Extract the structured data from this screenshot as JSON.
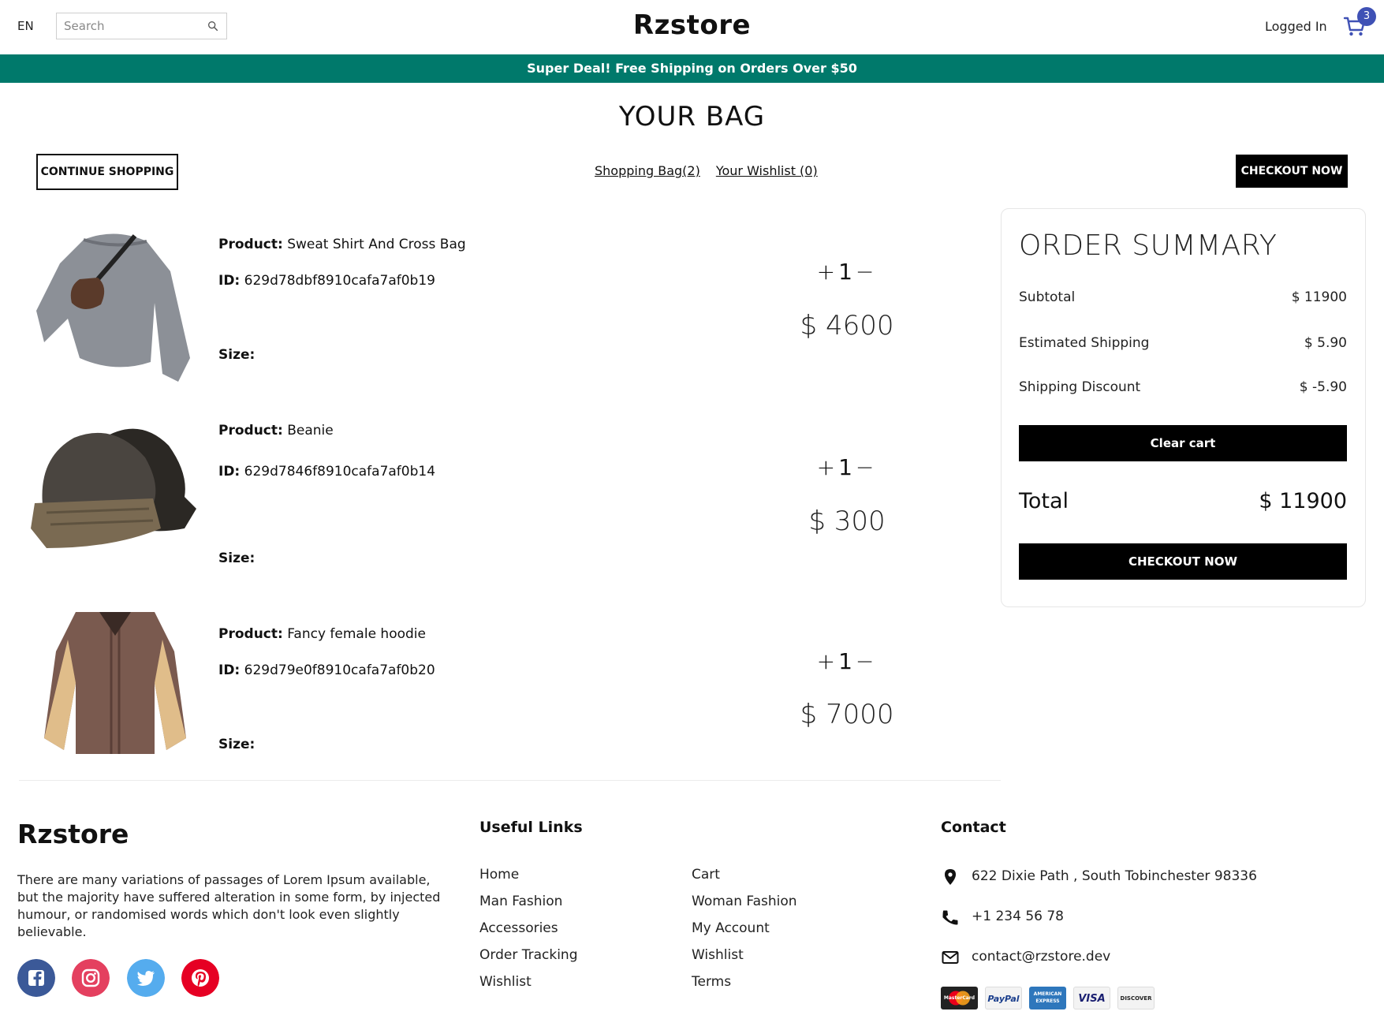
{
  "header": {
    "language": "EN",
    "search_placeholder": "Search",
    "brand": "Rzstore",
    "auth_status": "Logged In",
    "cart_count": "3"
  },
  "promo_banner": "Super Deal! Free Shipping on Orders Over $50",
  "page_title": "YOUR BAG",
  "actions": {
    "continue_shopping": "CONTINUE SHOPPING",
    "shopping_bag_link": "Shopping Bag(2)",
    "wishlist_link": "Your Wishlist (0)",
    "checkout_now": "CHECKOUT NOW"
  },
  "labels": {
    "product": "Product:",
    "id": "ID:",
    "size": "Size:",
    "plus": "+",
    "minus": "−"
  },
  "cart_items": [
    {
      "name": "Sweat Shirt And Cross Bag",
      "id": "629d78dbf8910cafa7af0b19",
      "size": "",
      "quantity": "1",
      "price": "$ 4600",
      "image": "grey-sweater-with-crossbody-bag"
    },
    {
      "name": "Beanie",
      "id": "629d7846f8910cafa7af0b14",
      "size": "",
      "quantity": "1",
      "price": "$ 300",
      "image": "two-knit-beanies"
    },
    {
      "name": "Fancy female hoodie",
      "id": "629d79e0f8910cafa7af0b20",
      "size": "",
      "quantity": "1",
      "price": "$ 7000",
      "image": "brown-beige-bomber-jacket"
    }
  ],
  "order_summary": {
    "title": "ORDER SUMMARY",
    "subtotal_label": "Subtotal",
    "subtotal_value": "$ 11900",
    "shipping_label": "Estimated Shipping",
    "shipping_value": "$ 5.90",
    "discount_label": "Shipping Discount",
    "discount_value": "$ -5.90",
    "clear_cart": "Clear cart",
    "total_label": "Total",
    "total_value": "$ 11900",
    "checkout": "CHECKOUT NOW"
  },
  "footer": {
    "brand": "Rzstore",
    "description": "There are many variations of passages of Lorem Ipsum available, but the majority have suffered alteration in some form, by injected humour, or randomised words which don't look even slightly believable.",
    "social": [
      "facebook-icon",
      "instagram-icon",
      "twitter-icon",
      "pinterest-icon"
    ],
    "useful_links_title": "Useful Links",
    "links_col1": [
      "Home",
      "Man Fashion",
      "Accessories",
      "Order Tracking",
      "Wishlist"
    ],
    "links_col2": [
      "Cart",
      "Woman Fashion",
      "My Account",
      "Wishlist",
      "Terms"
    ],
    "contact_title": "Contact",
    "address": "622 Dixie Path , South Tobinchester 98336",
    "phone": "+1 234 56 78",
    "email": "contact@rzstore.dev",
    "payments": [
      "MasterCard",
      "PayPal",
      "AMERICAN EXPRESS",
      "VISA",
      "DISCOVER"
    ]
  },
  "colors": {
    "promo_bg": "#00796b",
    "cart_badge": "#3f51b5",
    "facebook": "#3b5998",
    "instagram": "#e4405f",
    "twitter": "#55acee",
    "pinterest": "#e60023"
  }
}
